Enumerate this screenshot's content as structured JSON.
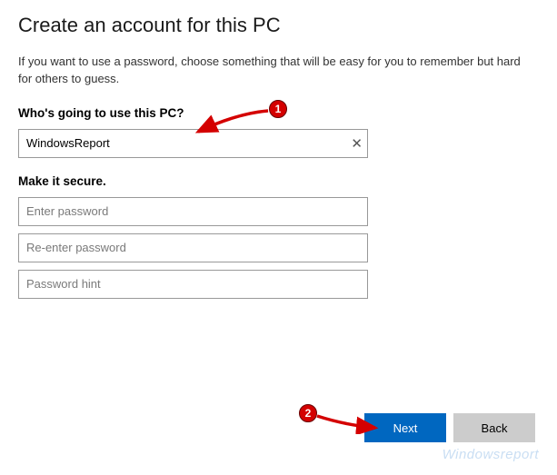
{
  "title": "Create an account for this PC",
  "subtitle": "If you want to use a password, choose something that will be easy for you to remember but hard for others to guess.",
  "section_user": {
    "label": "Who's going to use this PC?",
    "username_value": "WindowsReport",
    "clear_glyph": "✕"
  },
  "section_secure": {
    "label": "Make it secure.",
    "password_placeholder": "Enter password",
    "reenter_placeholder": "Re-enter password",
    "hint_placeholder": "Password hint"
  },
  "buttons": {
    "next": "Next",
    "back": "Back"
  },
  "annotations": {
    "badge1": "1",
    "badge2": "2"
  },
  "watermark": "Windowsreport"
}
